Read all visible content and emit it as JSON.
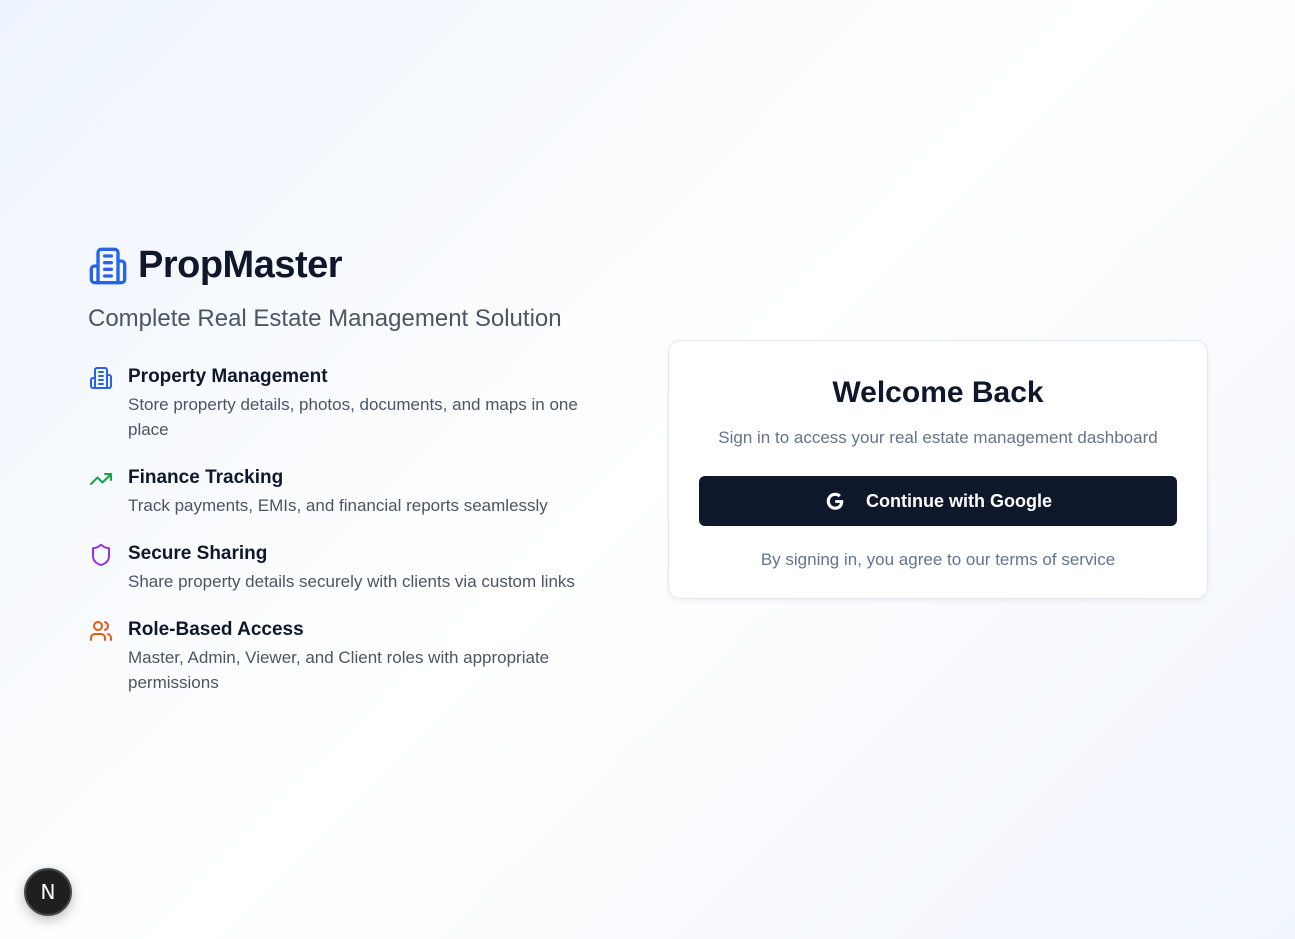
{
  "brand": {
    "name": "PropMaster",
    "tagline": "Complete Real Estate Management Solution",
    "icon": "building-icon",
    "color": "#2563eb"
  },
  "features": [
    {
      "icon": "building-icon",
      "color": "#2563eb",
      "title": "Property Management",
      "description": "Store property details, photos, documents, and maps in one place"
    },
    {
      "icon": "trending-up-icon",
      "color": "#16a34a",
      "title": "Finance Tracking",
      "description": "Track payments, EMIs, and financial reports seamlessly"
    },
    {
      "icon": "shield-icon",
      "color": "#9333ea",
      "title": "Secure Sharing",
      "description": "Share property details securely with clients via custom links"
    },
    {
      "icon": "users-icon",
      "color": "#ea580c",
      "title": "Role-Based Access",
      "description": "Master, Admin, Viewer, and Client roles with appropriate permissions"
    }
  ],
  "login": {
    "title": "Welcome Back",
    "subtitle": "Sign in to access your real estate management dashboard",
    "google_button_label": "Continue with Google",
    "google_icon": "google-icon",
    "terms": "By signing in, you agree to our terms of service"
  },
  "dev_badge": {
    "label": "N",
    "icon": "nextjs-icon"
  }
}
